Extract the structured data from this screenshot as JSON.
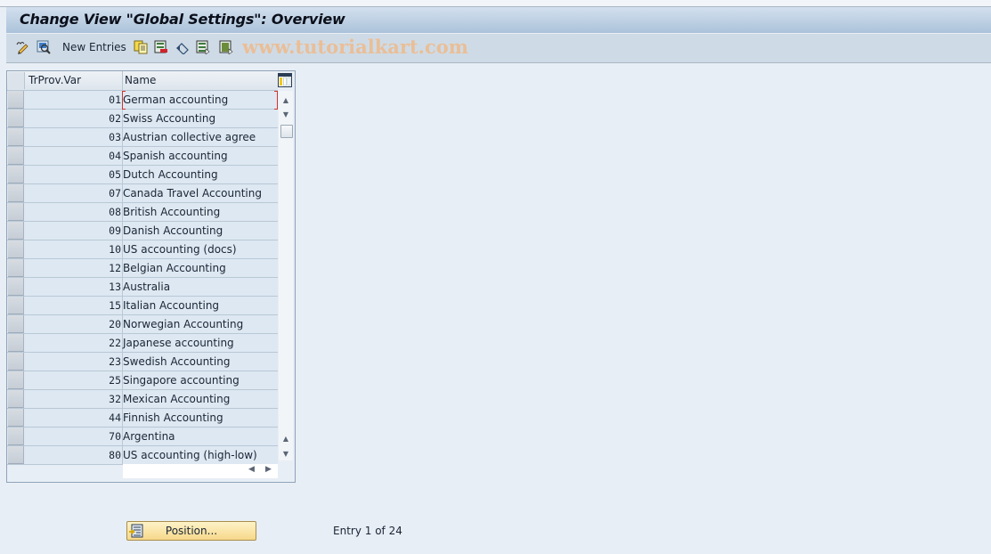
{
  "window": {
    "title": "Change View \"Global Settings\": Overview"
  },
  "toolbar": {
    "items": [
      {
        "icon": "display-change-icon",
        "label": ""
      },
      {
        "icon": "details-icon",
        "label": ""
      },
      {
        "icon": "",
        "label": "New Entries"
      },
      {
        "icon": "copy-as-icon",
        "label": ""
      },
      {
        "icon": "delete-icon",
        "label": ""
      },
      {
        "icon": "undo-change-icon",
        "label": ""
      },
      {
        "icon": "select-all-icon",
        "label": ""
      },
      {
        "icon": "select-block-icon",
        "label": ""
      }
    ],
    "watermark": "www.tutorialkart.com"
  },
  "table": {
    "columns": [
      "TrProv.Var",
      "Name"
    ],
    "rows": [
      {
        "key": "01",
        "name": "German accounting"
      },
      {
        "key": "02",
        "name": "Swiss Accounting"
      },
      {
        "key": "03",
        "name": "Austrian collective agree"
      },
      {
        "key": "04",
        "name": "Spanish accounting"
      },
      {
        "key": "05",
        "name": "Dutch Accounting"
      },
      {
        "key": "07",
        "name": "Canada Travel Accounting"
      },
      {
        "key": "08",
        "name": "British Accounting"
      },
      {
        "key": "09",
        "name": "Danish Accounting"
      },
      {
        "key": "10",
        "name": "US accounting (docs)"
      },
      {
        "key": "12",
        "name": "Belgian Accounting"
      },
      {
        "key": "13",
        "name": "Australia"
      },
      {
        "key": "15",
        "name": "Italian Accounting"
      },
      {
        "key": "20",
        "name": "Norwegian Accounting"
      },
      {
        "key": "22",
        "name": "Japanese accounting"
      },
      {
        "key": "23",
        "name": "Swedish Accounting"
      },
      {
        "key": "25",
        "name": "Singapore accounting"
      },
      {
        "key": "32",
        "name": "Mexican Accounting"
      },
      {
        "key": "44",
        "name": "Finnish Accounting"
      },
      {
        "key": "70",
        "name": "Argentina"
      },
      {
        "key": "80",
        "name": "US accounting (high-low)"
      }
    ],
    "focused_row": 0
  },
  "footer": {
    "position_button": "Position...",
    "entry_status": "Entry 1 of 24"
  },
  "colors": {
    "focus": "#d0342c",
    "button_bg": "#f7d88a",
    "row_bg": "#dde8f2"
  }
}
